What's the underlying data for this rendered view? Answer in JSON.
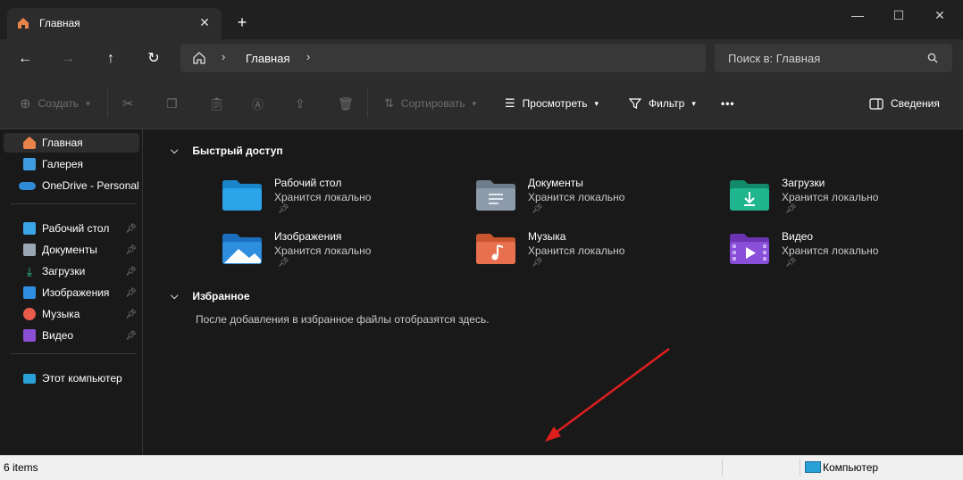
{
  "window": {
    "tab_title": "Главная",
    "icons": {
      "tab": "home-icon",
      "close": "close-icon",
      "new_tab": "plus-icon"
    }
  },
  "address": {
    "breadcrumb": "Главная",
    "search_placeholder": "Поиск в: Главная"
  },
  "toolbar": {
    "create": "Создать",
    "sort": "Сортировать",
    "view": "Просмотреть",
    "filter": "Фильтр",
    "more": "•••",
    "details": "Сведения"
  },
  "sidebar": {
    "top": [
      {
        "label": "Главная",
        "icon": "home-icon",
        "color": "#e8834a",
        "selected": true
      },
      {
        "label": "Галерея",
        "icon": "gallery-icon",
        "color": "#3f9be0"
      },
      {
        "label": "OneDrive - Personal",
        "icon": "onedrive-icon",
        "color": "#2f8bd8"
      }
    ],
    "pinned": [
      {
        "label": "Рабочий стол",
        "icon": "desktop-icon",
        "color": "#3aa6e8"
      },
      {
        "label": "Документы",
        "icon": "documents-icon",
        "color": "#9aa6b4"
      },
      {
        "label": "Загрузки",
        "icon": "downloads-icon",
        "color": "#2bc29a"
      },
      {
        "label": "Изображения",
        "icon": "pictures-icon",
        "color": "#2f8ee0"
      },
      {
        "label": "Музыка",
        "icon": "music-icon",
        "color": "#e85c4a"
      },
      {
        "label": "Видео",
        "icon": "video-icon",
        "color": "#8b4fd6"
      }
    ],
    "this_pc": {
      "label": "Этот компьютер",
      "icon": "computer-icon",
      "color": "#2aa0d8"
    }
  },
  "main": {
    "quick_access": {
      "title": "Быстрый доступ",
      "items": [
        {
          "name": "Рабочий стол",
          "sub": "Хранится локально",
          "icon": "desktop-folder-icon",
          "color": "#2ba4e9"
        },
        {
          "name": "Документы",
          "sub": "Хранится локально",
          "icon": "documents-folder-icon",
          "color": "#8e9bab"
        },
        {
          "name": "Загрузки",
          "sub": "Хранится локально",
          "icon": "downloads-folder-icon",
          "color": "#1fb58e"
        },
        {
          "name": "Изображения",
          "sub": "Хранится локально",
          "icon": "pictures-folder-icon",
          "color": "#2e8ee0"
        },
        {
          "name": "Музыка",
          "sub": "Хранится локально",
          "icon": "music-folder-icon",
          "color": "#e8704f"
        },
        {
          "name": "Видео",
          "sub": "Хранится локально",
          "icon": "video-folder-icon",
          "color": "#8a4fd8"
        }
      ]
    },
    "favorites": {
      "title": "Избранное",
      "empty_text": "После добавления в избранное файлы отобразятся здесь."
    }
  },
  "status": {
    "items": "6 items",
    "location": "Компьютер"
  },
  "annotation": {
    "icon": "red-arrow-annotation",
    "color": "#e01e1e"
  }
}
